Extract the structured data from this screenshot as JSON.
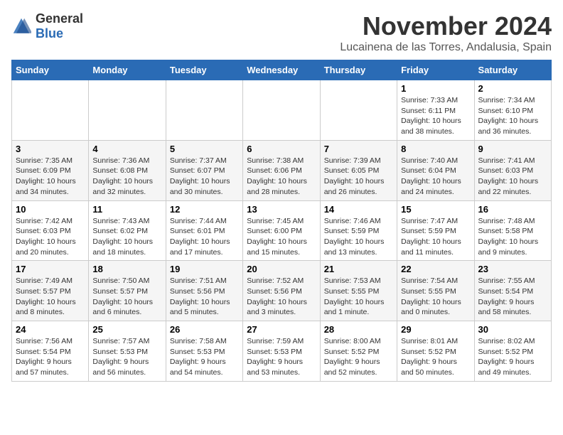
{
  "header": {
    "logo_general": "General",
    "logo_blue": "Blue",
    "month_title": "November 2024",
    "location": "Lucainena de las Torres, Andalusia, Spain"
  },
  "weekdays": [
    "Sunday",
    "Monday",
    "Tuesday",
    "Wednesday",
    "Thursday",
    "Friday",
    "Saturday"
  ],
  "weeks": [
    {
      "cells": [
        {
          "day": "",
          "info": ""
        },
        {
          "day": "",
          "info": ""
        },
        {
          "day": "",
          "info": ""
        },
        {
          "day": "",
          "info": ""
        },
        {
          "day": "",
          "info": ""
        },
        {
          "day": "1",
          "info": "Sunrise: 7:33 AM\nSunset: 6:11 PM\nDaylight: 10 hours and 38 minutes."
        },
        {
          "day": "2",
          "info": "Sunrise: 7:34 AM\nSunset: 6:10 PM\nDaylight: 10 hours and 36 minutes."
        }
      ]
    },
    {
      "cells": [
        {
          "day": "3",
          "info": "Sunrise: 7:35 AM\nSunset: 6:09 PM\nDaylight: 10 hours and 34 minutes."
        },
        {
          "day": "4",
          "info": "Sunrise: 7:36 AM\nSunset: 6:08 PM\nDaylight: 10 hours and 32 minutes."
        },
        {
          "day": "5",
          "info": "Sunrise: 7:37 AM\nSunset: 6:07 PM\nDaylight: 10 hours and 30 minutes."
        },
        {
          "day": "6",
          "info": "Sunrise: 7:38 AM\nSunset: 6:06 PM\nDaylight: 10 hours and 28 minutes."
        },
        {
          "day": "7",
          "info": "Sunrise: 7:39 AM\nSunset: 6:05 PM\nDaylight: 10 hours and 26 minutes."
        },
        {
          "day": "8",
          "info": "Sunrise: 7:40 AM\nSunset: 6:04 PM\nDaylight: 10 hours and 24 minutes."
        },
        {
          "day": "9",
          "info": "Sunrise: 7:41 AM\nSunset: 6:03 PM\nDaylight: 10 hours and 22 minutes."
        }
      ]
    },
    {
      "cells": [
        {
          "day": "10",
          "info": "Sunrise: 7:42 AM\nSunset: 6:03 PM\nDaylight: 10 hours and 20 minutes."
        },
        {
          "day": "11",
          "info": "Sunrise: 7:43 AM\nSunset: 6:02 PM\nDaylight: 10 hours and 18 minutes."
        },
        {
          "day": "12",
          "info": "Sunrise: 7:44 AM\nSunset: 6:01 PM\nDaylight: 10 hours and 17 minutes."
        },
        {
          "day": "13",
          "info": "Sunrise: 7:45 AM\nSunset: 6:00 PM\nDaylight: 10 hours and 15 minutes."
        },
        {
          "day": "14",
          "info": "Sunrise: 7:46 AM\nSunset: 5:59 PM\nDaylight: 10 hours and 13 minutes."
        },
        {
          "day": "15",
          "info": "Sunrise: 7:47 AM\nSunset: 5:59 PM\nDaylight: 10 hours and 11 minutes."
        },
        {
          "day": "16",
          "info": "Sunrise: 7:48 AM\nSunset: 5:58 PM\nDaylight: 10 hours and 9 minutes."
        }
      ]
    },
    {
      "cells": [
        {
          "day": "17",
          "info": "Sunrise: 7:49 AM\nSunset: 5:57 PM\nDaylight: 10 hours and 8 minutes."
        },
        {
          "day": "18",
          "info": "Sunrise: 7:50 AM\nSunset: 5:57 PM\nDaylight: 10 hours and 6 minutes."
        },
        {
          "day": "19",
          "info": "Sunrise: 7:51 AM\nSunset: 5:56 PM\nDaylight: 10 hours and 5 minutes."
        },
        {
          "day": "20",
          "info": "Sunrise: 7:52 AM\nSunset: 5:56 PM\nDaylight: 10 hours and 3 minutes."
        },
        {
          "day": "21",
          "info": "Sunrise: 7:53 AM\nSunset: 5:55 PM\nDaylight: 10 hours and 1 minute."
        },
        {
          "day": "22",
          "info": "Sunrise: 7:54 AM\nSunset: 5:55 PM\nDaylight: 10 hours and 0 minutes."
        },
        {
          "day": "23",
          "info": "Sunrise: 7:55 AM\nSunset: 5:54 PM\nDaylight: 9 hours and 58 minutes."
        }
      ]
    },
    {
      "cells": [
        {
          "day": "24",
          "info": "Sunrise: 7:56 AM\nSunset: 5:54 PM\nDaylight: 9 hours and 57 minutes."
        },
        {
          "day": "25",
          "info": "Sunrise: 7:57 AM\nSunset: 5:53 PM\nDaylight: 9 hours and 56 minutes."
        },
        {
          "day": "26",
          "info": "Sunrise: 7:58 AM\nSunset: 5:53 PM\nDaylight: 9 hours and 54 minutes."
        },
        {
          "day": "27",
          "info": "Sunrise: 7:59 AM\nSunset: 5:53 PM\nDaylight: 9 hours and 53 minutes."
        },
        {
          "day": "28",
          "info": "Sunrise: 8:00 AM\nSunset: 5:52 PM\nDaylight: 9 hours and 52 minutes."
        },
        {
          "day": "29",
          "info": "Sunrise: 8:01 AM\nSunset: 5:52 PM\nDaylight: 9 hours and 50 minutes."
        },
        {
          "day": "30",
          "info": "Sunrise: 8:02 AM\nSunset: 5:52 PM\nDaylight: 9 hours and 49 minutes."
        }
      ]
    }
  ]
}
